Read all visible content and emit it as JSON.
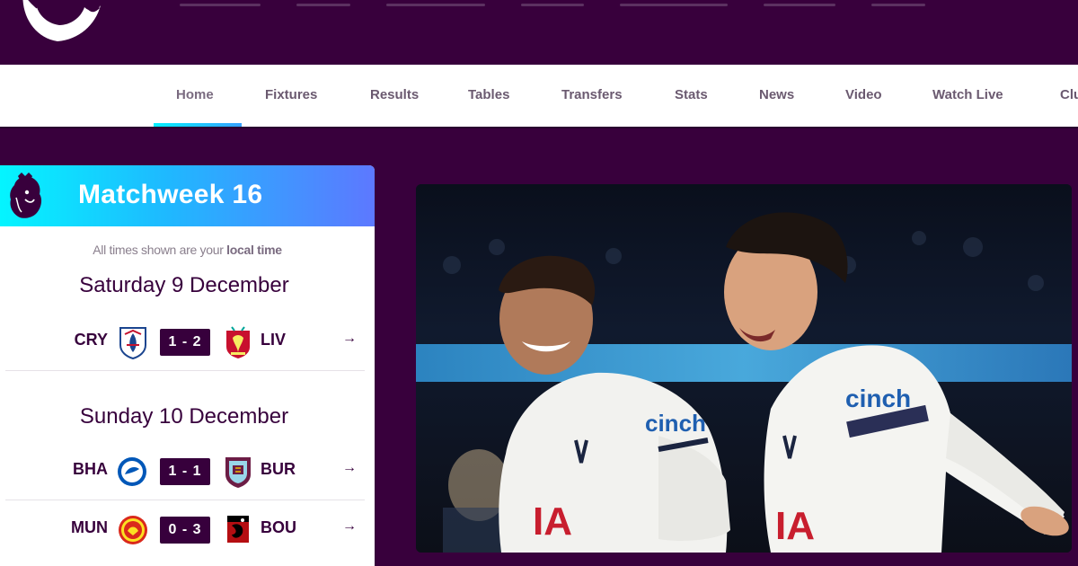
{
  "nav": {
    "items": [
      {
        "label": "Home",
        "active": true
      },
      {
        "label": "Fixtures"
      },
      {
        "label": "Results"
      },
      {
        "label": "Tables"
      },
      {
        "label": "Transfers"
      },
      {
        "label": "Stats"
      },
      {
        "label": "News"
      },
      {
        "label": "Video"
      },
      {
        "label": "Watch Live"
      },
      {
        "label": "Clu"
      }
    ]
  },
  "matchweek": {
    "title": "Matchweek 16",
    "note_prefix": "All times shown are your ",
    "note_bold": "local time",
    "days": [
      {
        "date": "Saturday 9 December",
        "fixtures": [
          {
            "home": "CRY",
            "score": "1 - 2",
            "away": "LIV",
            "arrow": "→"
          }
        ]
      },
      {
        "date": "Sunday 10 December",
        "fixtures": [
          {
            "home": "BHA",
            "score": "1 - 1",
            "away": "BUR",
            "arrow": "→"
          },
          {
            "home": "MUN",
            "score": "0 - 3",
            "away": "BOU",
            "arrow": "→"
          }
        ]
      }
    ]
  },
  "hero": {
    "sponsor_text": "cinch"
  },
  "colors": {
    "brand_purple": "#38003c",
    "accent_cyan": "#04f5ff",
    "accent_blue": "#5d78ff"
  }
}
